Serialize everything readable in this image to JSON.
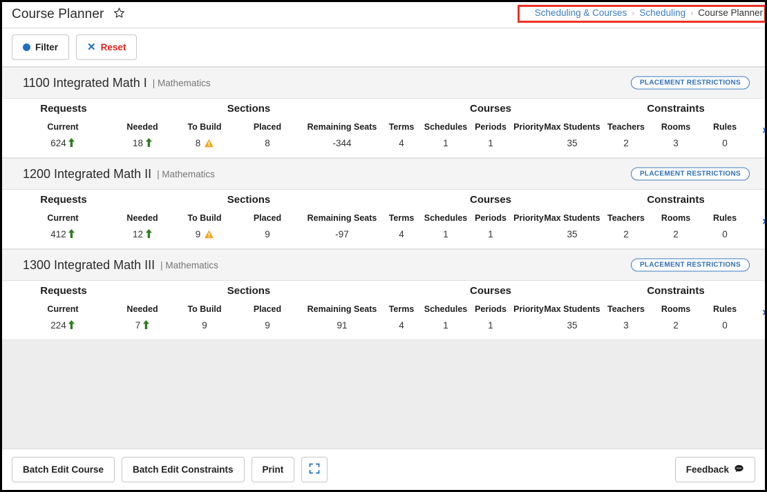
{
  "header": {
    "title": "Course Planner",
    "favorite_icon": "star-outline-icon",
    "breadcrumb": {
      "items": [
        {
          "label": "Scheduling & Courses",
          "type": "link"
        },
        {
          "label": "Scheduling",
          "type": "link"
        },
        {
          "label": "Course Planner",
          "type": "current"
        }
      ],
      "separator": "›",
      "annotation_color": "#ef3124"
    }
  },
  "toolbar": {
    "filter_label": "Filter",
    "filter_icon": "filled-circle-icon",
    "reset_label": "Reset",
    "reset_icon": "x-close-icon"
  },
  "table": {
    "groups": [
      {
        "label": "Requests",
        "center": 89
      },
      {
        "label": "Sections",
        "center": 357
      },
      {
        "label": "Courses",
        "center": 707
      },
      {
        "label": "Constraints",
        "center": 975
      }
    ],
    "columns": [
      {
        "key": "current",
        "label": "Current",
        "center": 88
      },
      {
        "key": "needed",
        "label": "Needed",
        "center": 203
      },
      {
        "key": "to_build",
        "label": "To Build",
        "center": 293
      },
      {
        "key": "placed",
        "label": "Placed",
        "center": 384
      },
      {
        "key": "remaining_seats",
        "label": "Remaining Seats",
        "center": 492
      },
      {
        "key": "terms",
        "label": "Terms",
        "center": 578
      },
      {
        "key": "schedules",
        "label": "Schedules",
        "center": 642
      },
      {
        "key": "periods",
        "label": "Periods",
        "center": 707
      },
      {
        "key": "priority",
        "label": "Priority",
        "center": 762
      },
      {
        "key": "max_students",
        "label": "Max Students",
        "center": 825
      },
      {
        "key": "teachers",
        "label": "Teachers",
        "center": 903
      },
      {
        "key": "rooms",
        "label": "Rooms",
        "center": 975
      },
      {
        "key": "rules",
        "label": "Rules",
        "center": 1046
      }
    ],
    "row_expand_icon": "chevron-right-icon",
    "badge_label": "PLACEMENT RESTRICTIONS"
  },
  "courses": [
    {
      "code_name": "1100 Integrated Math I",
      "department": "| Mathematics",
      "badge": "PLACEMENT RESTRICTIONS",
      "values": {
        "current": "624",
        "needed": "18",
        "to_build": "8",
        "placed": "8",
        "remaining_seats": "-344",
        "terms": "4",
        "schedules": "1",
        "periods": "1",
        "priority": "",
        "max_students": "35",
        "teachers": "2",
        "rooms": "3",
        "rules": "0"
      },
      "indicators": {
        "current": "arrow-up-green",
        "needed": "arrow-up-green",
        "to_build": "warning-triangle"
      }
    },
    {
      "code_name": "1200 Integrated Math II",
      "department": "| Mathematics",
      "badge": "PLACEMENT RESTRICTIONS",
      "values": {
        "current": "412",
        "needed": "12",
        "to_build": "9",
        "placed": "9",
        "remaining_seats": "-97",
        "terms": "4",
        "schedules": "1",
        "periods": "1",
        "priority": "",
        "max_students": "35",
        "teachers": "2",
        "rooms": "2",
        "rules": "0"
      },
      "indicators": {
        "current": "arrow-up-green",
        "needed": "arrow-up-green",
        "to_build": "warning-triangle"
      }
    },
    {
      "code_name": "1300 Integrated Math III",
      "department": "| Mathematics",
      "badge": "PLACEMENT RESTRICTIONS",
      "values": {
        "current": "224",
        "needed": "7",
        "to_build": "9",
        "placed": "9",
        "remaining_seats": "91",
        "terms": "4",
        "schedules": "1",
        "periods": "1",
        "priority": "",
        "max_students": "35",
        "teachers": "3",
        "rooms": "2",
        "rules": "0"
      },
      "indicators": {
        "current": "arrow-up-green",
        "needed": "arrow-up-green",
        "to_build": ""
      }
    }
  ],
  "footer": {
    "batch_edit_course_label": "Batch Edit Course",
    "batch_edit_constraints_label": "Batch Edit Constraints",
    "print_label": "Print",
    "fullscreen_icon": "expand-fullscreen-icon",
    "feedback_label": "Feedback",
    "feedback_icon": "speech-bubble-icon"
  },
  "colors": {
    "link": "#3d7bbf",
    "accent_blue": "#1d6fc4",
    "reset_red": "#e0241a",
    "annotation_red": "#ef3124",
    "arrow_green": "#2e7d1e",
    "warning_amber": "#f5a623",
    "page_bg": "#ededed"
  }
}
